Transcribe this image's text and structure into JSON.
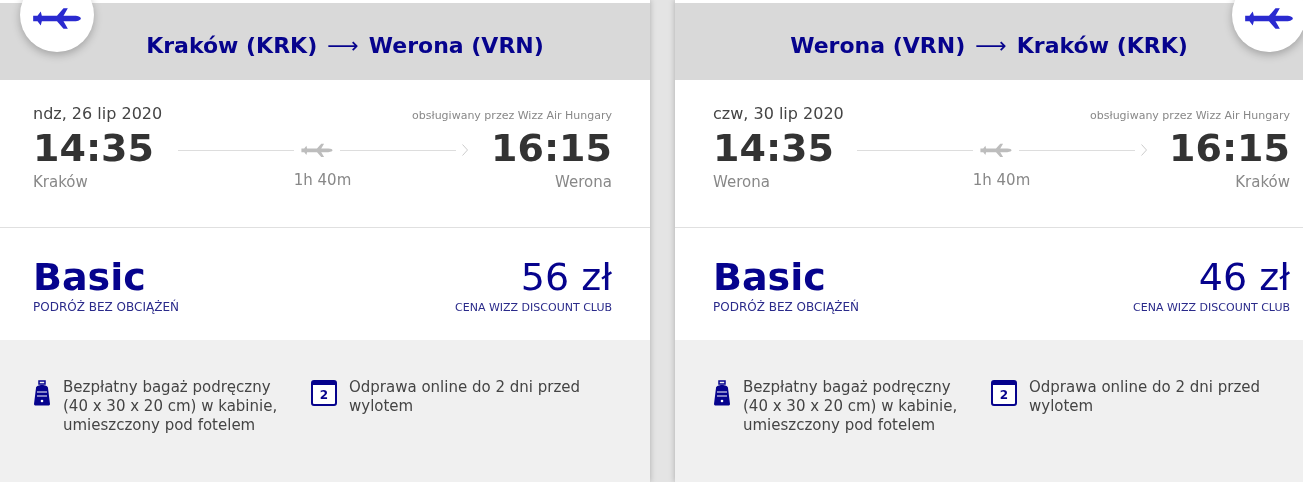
{
  "flights": [
    {
      "route_from": "Kraków (KRK)",
      "arrow": "⟶",
      "route_to": "Werona (VRN)",
      "date": "ndz, 26 lip 2020",
      "operator": "obsługiwany przez Wizz Air Hungary",
      "departure_time": "14:35",
      "departure_city": "Kraków",
      "duration": "1h 40m",
      "arrival_time": "16:15",
      "arrival_city": "Werona",
      "fare_name": "Basic",
      "fare_subtitle": "PODRÓŻ BEZ OBCIĄŻEŃ",
      "price": "56 zł",
      "price_note": "CENA WIZZ DISCOUNT CLUB",
      "features": [
        {
          "kind": "bag",
          "text": "Bezpłatny bagaż podręczny (40 x 30 x 20 cm) w kabinie, umieszczony pod fotelem"
        },
        {
          "kind": "calendar",
          "icon_text": "2",
          "text": "Odprawa online do 2 dni przed wylotem"
        }
      ]
    },
    {
      "route_from": "Werona (VRN)",
      "arrow": "⟶",
      "route_to": "Kraków (KRK)",
      "date": "czw, 30 lip 2020",
      "operator": "obsługiwany przez Wizz Air Hungary",
      "departure_time": "14:35",
      "departure_city": "Werona",
      "duration": "1h 40m",
      "arrival_time": "16:15",
      "arrival_city": "Kraków",
      "fare_name": "Basic",
      "fare_subtitle": "PODRÓŻ BEZ OBCIĄŻEŃ",
      "price": "46 zł",
      "price_note": "CENA WIZZ DISCOUNT CLUB",
      "features": [
        {
          "kind": "bag",
          "text": "Bezpłatny bagaż podręczny (40 x 30 x 20 cm) w kabinie, umieszczony pod fotelem"
        },
        {
          "kind": "calendar",
          "icon_text": "2",
          "text": "Odprawa online do 2 dni przed wylotem"
        }
      ]
    }
  ]
}
